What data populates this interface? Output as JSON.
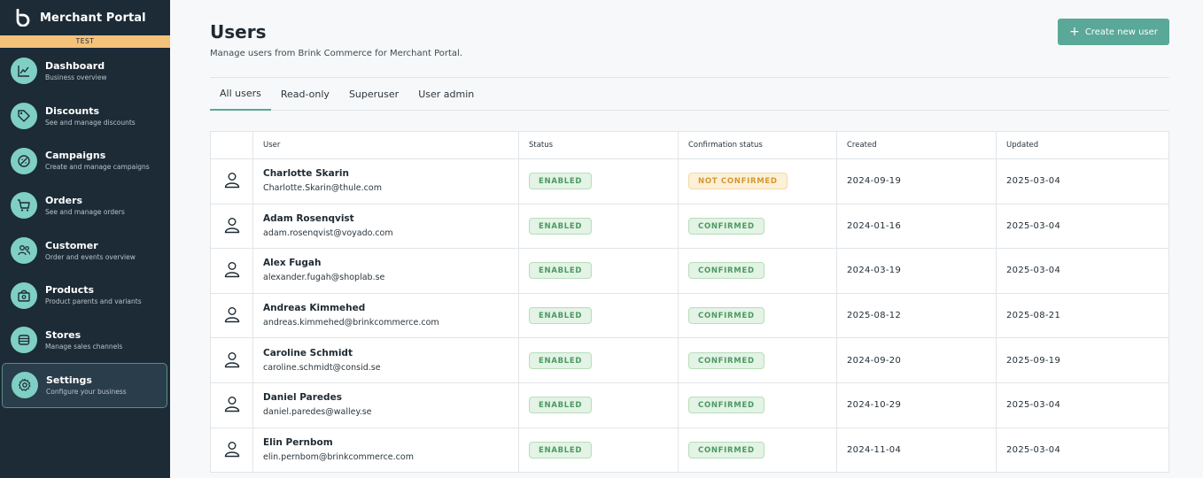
{
  "brand": {
    "name": "Merchant Portal",
    "env": "TEST"
  },
  "nav": [
    {
      "label": "Dashboard",
      "sub": "Business overview",
      "icon": "chart-icon"
    },
    {
      "label": "Discounts",
      "sub": "See and manage discounts",
      "icon": "tag-icon"
    },
    {
      "label": "Campaigns",
      "sub": "Create and manage campaigns",
      "icon": "campaign-icon"
    },
    {
      "label": "Orders",
      "sub": "See and manage orders",
      "icon": "cart-icon"
    },
    {
      "label": "Customer",
      "sub": "Order and events overview",
      "icon": "users-icon"
    },
    {
      "label": "Products",
      "sub": "Product parents and variants",
      "icon": "box-icon"
    },
    {
      "label": "Stores",
      "sub": "Manage sales channels",
      "icon": "store-icon"
    },
    {
      "label": "Settings",
      "sub": "Configure your business",
      "icon": "gear-icon"
    }
  ],
  "page": {
    "title": "Users",
    "description": "Manage users from Brink Commerce for Merchant Portal.",
    "create_button": "Create new user"
  },
  "tabs": [
    "All users",
    "Read-only",
    "Superuser",
    "User admin"
  ],
  "table": {
    "headers": [
      "",
      "User",
      "Status",
      "Confirmation status",
      "Created",
      "Updated"
    ],
    "rows": [
      {
        "name": "Charlotte Skarin",
        "email": "Charlotte.Skarin@thule.com",
        "status": "ENABLED",
        "confirmation": "NOT CONFIRMED",
        "created": "2024-09-19",
        "updated": "2025-03-04"
      },
      {
        "name": "Adam Rosenqvist",
        "email": "adam.rosenqvist@voyado.com",
        "status": "ENABLED",
        "confirmation": "CONFIRMED",
        "created": "2024-01-16",
        "updated": "2025-03-04"
      },
      {
        "name": "Alex Fugah",
        "email": "alexander.fugah@shoplab.se",
        "status": "ENABLED",
        "confirmation": "CONFIRMED",
        "created": "2024-03-19",
        "updated": "2025-03-04"
      },
      {
        "name": "Andreas Kimmehed",
        "email": "andreas.kimmehed@brinkcommerce.com",
        "status": "ENABLED",
        "confirmation": "CONFIRMED",
        "created": "2025-08-12",
        "updated": "2025-08-21"
      },
      {
        "name": "Caroline Schmidt",
        "email": "caroline.schmidt@consid.se",
        "status": "ENABLED",
        "confirmation": "CONFIRMED",
        "created": "2024-09-20",
        "updated": "2025-09-19"
      },
      {
        "name": "Daniel Paredes",
        "email": "daniel.paredes@walley.se",
        "status": "ENABLED",
        "confirmation": "CONFIRMED",
        "created": "2024-10-29",
        "updated": "2025-03-04"
      },
      {
        "name": "Elin Pernbom",
        "email": "elin.pernbom@brinkcommerce.com",
        "status": "ENABLED",
        "confirmation": "CONFIRMED",
        "created": "2024-11-04",
        "updated": "2025-03-04"
      }
    ]
  },
  "colors": {
    "sidebar": "#1c2b36",
    "accent": "#5aa898",
    "env_badge": "#f4c27a",
    "nav_icon": "#7fcfc4"
  }
}
